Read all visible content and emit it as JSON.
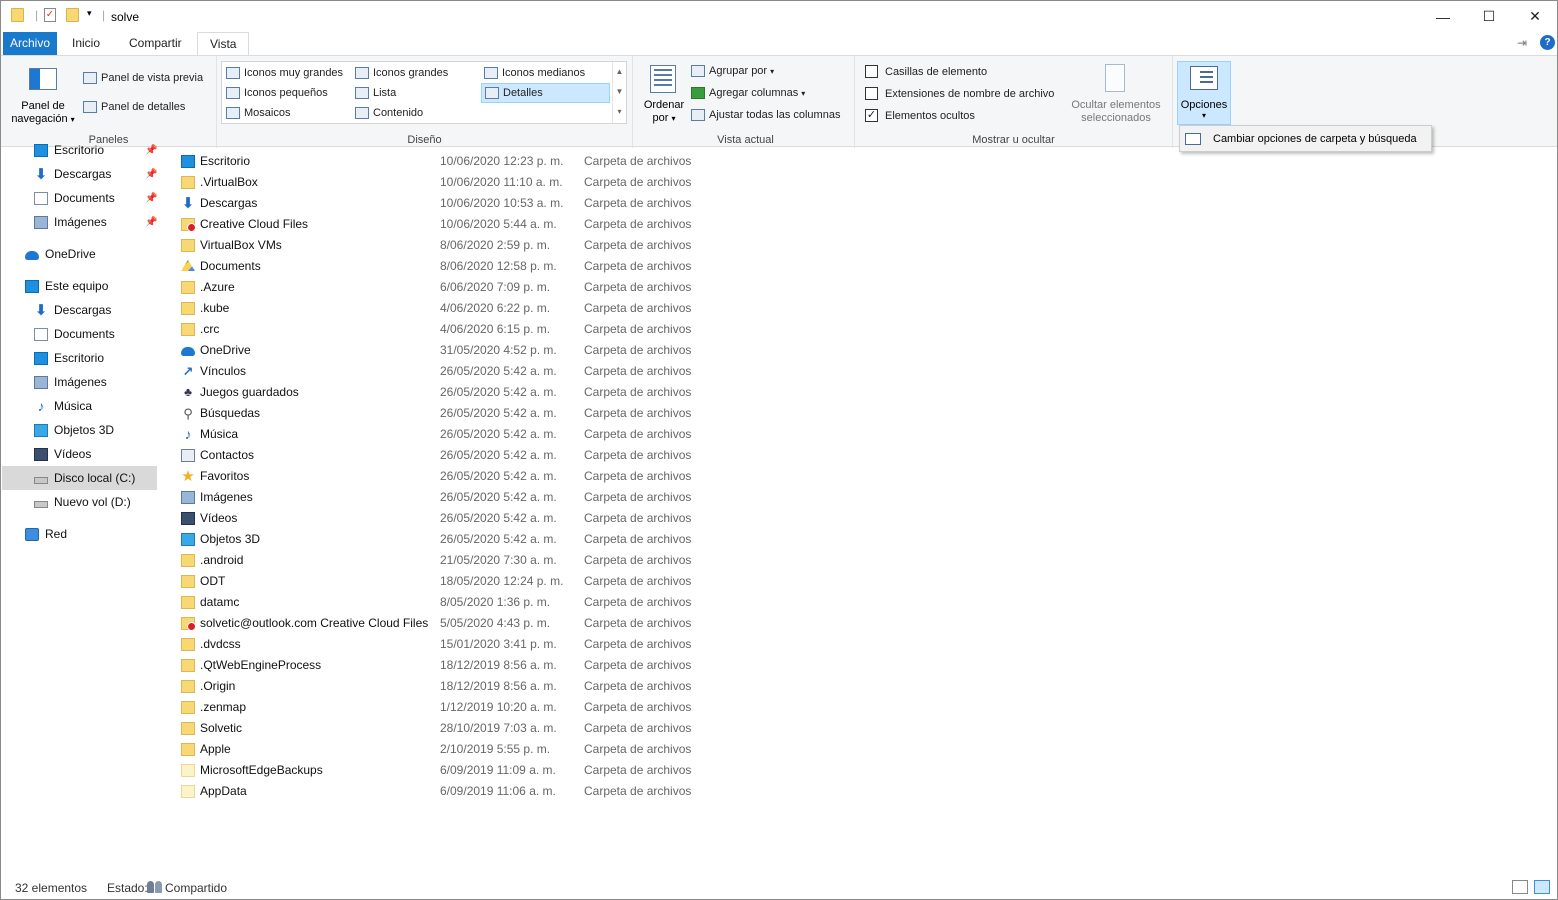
{
  "window": {
    "title": "solve",
    "controls": {
      "minimize": "—",
      "maximize": "☐",
      "close": "✕"
    }
  },
  "ribbon_tabs": {
    "file": "Archivo",
    "home": "Inicio",
    "share": "Compartir",
    "view": "Vista"
  },
  "ribbon": {
    "panes": {
      "nav_pane_line1": "Panel de",
      "nav_pane_line2": "navegación",
      "preview_pane": "Panel de vista previa",
      "details_pane": "Panel de detalles",
      "label": "Paneles"
    },
    "layout": {
      "extra_large": "Iconos muy grandes",
      "large": "Iconos grandes",
      "medium": "Iconos medianos",
      "small": "Iconos pequeños",
      "list": "Lista",
      "details": "Detalles",
      "tiles": "Mosaicos",
      "content": "Contenido",
      "label": "Diseño"
    },
    "current_view": {
      "sort_line1": "Ordenar",
      "sort_line2": "por",
      "group_by": "Agrupar por",
      "add_columns": "Agregar columnas",
      "size_columns": "Ajustar todas las columnas",
      "label": "Vista actual"
    },
    "show_hide": {
      "item_checkboxes": "Casillas de elemento",
      "item_checkboxes_checked": false,
      "file_extensions": "Extensiones de nombre de archivo",
      "file_extensions_checked": false,
      "hidden_items": "Elementos ocultos",
      "hidden_items_checked": true,
      "hide_selected_line1": "Ocultar elementos",
      "hide_selected_line2": "seleccionados",
      "label": "Mostrar u ocultar"
    },
    "options": {
      "label": "Opciones"
    }
  },
  "options_menu": {
    "item": "Cambiar opciones de carpeta y búsqueda"
  },
  "nav_pane": {
    "quick_access": [
      {
        "label": "Escritorio",
        "icon": "desktop-icon",
        "pinned": true
      },
      {
        "label": "Descargas",
        "icon": "download-icon",
        "pinned": true
      },
      {
        "label": "Documents",
        "icon": "document-icon",
        "pinned": true
      },
      {
        "label": "Imágenes",
        "icon": "pictures-icon",
        "pinned": true
      }
    ],
    "onedrive": "OneDrive",
    "this_pc": "Este equipo",
    "this_pc_items": [
      {
        "label": "Descargas",
        "icon": "download-icon"
      },
      {
        "label": "Documents",
        "icon": "document-icon"
      },
      {
        "label": "Escritorio",
        "icon": "desktop-icon"
      },
      {
        "label": "Imágenes",
        "icon": "pictures-icon"
      },
      {
        "label": "Música",
        "icon": "music-icon"
      },
      {
        "label": "Objetos 3D",
        "icon": "cube-icon"
      },
      {
        "label": "Vídeos",
        "icon": "video-icon"
      },
      {
        "label": "Disco local (C:)",
        "icon": "drive-icon",
        "selected": true
      },
      {
        "label": "Nuevo vol (D:)",
        "icon": "drive-icon"
      }
    ],
    "network": "Red"
  },
  "files": [
    {
      "name": "Escritorio",
      "date": "10/06/2020 12:23 p. m.",
      "type": "Carpeta de archivos",
      "icon": "desktop-icon"
    },
    {
      "name": ".VirtualBox",
      "date": "10/06/2020 11:10 a. m.",
      "type": "Carpeta de archivos",
      "icon": "folder-icon"
    },
    {
      "name": "Descargas",
      "date": "10/06/2020 10:53 a. m.",
      "type": "Carpeta de archivos",
      "icon": "download-icon"
    },
    {
      "name": "Creative Cloud Files",
      "date": "10/06/2020 5:44 a. m.",
      "type": "Carpeta de archivos",
      "icon": "creative-cloud-icon"
    },
    {
      "name": "VirtualBox VMs",
      "date": "8/06/2020 2:59 p. m.",
      "type": "Carpeta de archivos",
      "icon": "folder-icon"
    },
    {
      "name": "Documents",
      "date": "8/06/2020 12:58 p. m.",
      "type": "Carpeta de archivos",
      "icon": "google-drive-icon"
    },
    {
      "name": ".Azure",
      "date": "6/06/2020 7:09 p. m.",
      "type": "Carpeta de archivos",
      "icon": "folder-icon"
    },
    {
      "name": ".kube",
      "date": "4/06/2020 6:22 p. m.",
      "type": "Carpeta de archivos",
      "icon": "folder-icon"
    },
    {
      "name": ".crc",
      "date": "4/06/2020 6:15 p. m.",
      "type": "Carpeta de archivos",
      "icon": "folder-icon"
    },
    {
      "name": "OneDrive",
      "date": "31/05/2020 4:52 p. m.",
      "type": "Carpeta de archivos",
      "icon": "onedrive-icon"
    },
    {
      "name": "Vínculos",
      "date": "26/05/2020 5:42 a. m.",
      "type": "Carpeta de archivos",
      "icon": "link-icon"
    },
    {
      "name": "Juegos guardados",
      "date": "26/05/2020 5:42 a. m.",
      "type": "Carpeta de archivos",
      "icon": "game-icon"
    },
    {
      "name": "Búsquedas",
      "date": "26/05/2020 5:42 a. m.",
      "type": "Carpeta de archivos",
      "icon": "search-icon"
    },
    {
      "name": "Música",
      "date": "26/05/2020 5:42 a. m.",
      "type": "Carpeta de archivos",
      "icon": "music-icon"
    },
    {
      "name": "Contactos",
      "date": "26/05/2020 5:42 a. m.",
      "type": "Carpeta de archivos",
      "icon": "contact-icon"
    },
    {
      "name": "Favoritos",
      "date": "26/05/2020 5:42 a. m.",
      "type": "Carpeta de archivos",
      "icon": "star-icon"
    },
    {
      "name": "Imágenes",
      "date": "26/05/2020 5:42 a. m.",
      "type": "Carpeta de archivos",
      "icon": "pictures-icon"
    },
    {
      "name": "Vídeos",
      "date": "26/05/2020 5:42 a. m.",
      "type": "Carpeta de archivos",
      "icon": "video-icon"
    },
    {
      "name": "Objetos 3D",
      "date": "26/05/2020 5:42 a. m.",
      "type": "Carpeta de archivos",
      "icon": "cube-icon"
    },
    {
      "name": ".android",
      "date": "21/05/2020 7:30 a. m.",
      "type": "Carpeta de archivos",
      "icon": "folder-icon"
    },
    {
      "name": "ODT",
      "date": "18/05/2020 12:24 p. m.",
      "type": "Carpeta de archivos",
      "icon": "folder-icon"
    },
    {
      "name": "datamc",
      "date": "8/05/2020 1:36 p. m.",
      "type": "Carpeta de archivos",
      "icon": "folder-icon"
    },
    {
      "name": "solvetic@outlook.com Creative Cloud Files",
      "date": "5/05/2020 4:43 p. m.",
      "type": "Carpeta de archivos",
      "icon": "creative-cloud-icon"
    },
    {
      "name": ".dvdcss",
      "date": "15/01/2020 3:41 p. m.",
      "type": "Carpeta de archivos",
      "icon": "folder-icon"
    },
    {
      "name": ".QtWebEngineProcess",
      "date": "18/12/2019 8:56 a. m.",
      "type": "Carpeta de archivos",
      "icon": "folder-icon"
    },
    {
      "name": ".Origin",
      "date": "18/12/2019 8:56 a. m.",
      "type": "Carpeta de archivos",
      "icon": "folder-icon"
    },
    {
      "name": ".zenmap",
      "date": "1/12/2019 10:20 a. m.",
      "type": "Carpeta de archivos",
      "icon": "folder-icon"
    },
    {
      "name": "Solvetic",
      "date": "28/10/2019 7:03 a. m.",
      "type": "Carpeta de archivos",
      "icon": "folder-icon"
    },
    {
      "name": "Apple",
      "date": "2/10/2019 5:55 p. m.",
      "type": "Carpeta de archivos",
      "icon": "folder-icon"
    },
    {
      "name": "MicrosoftEdgeBackups",
      "date": "6/09/2019 11:09 a. m.",
      "type": "Carpeta de archivos",
      "icon": "hidden-folder-icon"
    },
    {
      "name": "AppData",
      "date": "6/09/2019 11:06 a. m.",
      "type": "Carpeta de archivos",
      "icon": "hidden-folder-icon"
    }
  ],
  "status": {
    "count": "32 elementos",
    "state_label": "Estado:",
    "state_value": "Compartido"
  }
}
